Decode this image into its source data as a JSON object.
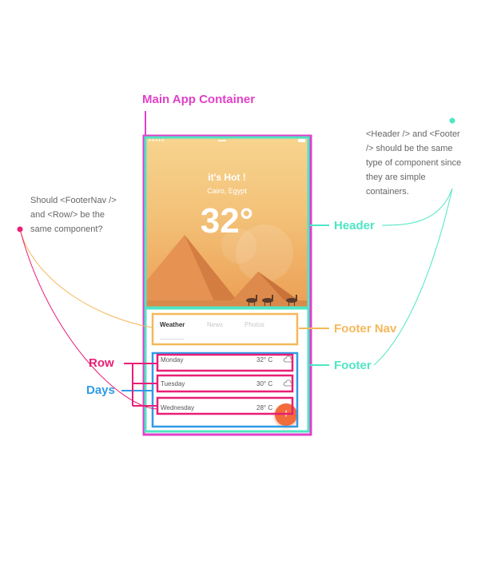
{
  "labels": {
    "main_container": "Main App Container",
    "header": "Header",
    "footer_nav": "Footer Nav",
    "footer": "Footer",
    "row": "Row",
    "days": "Days"
  },
  "notes": {
    "left": [
      "Should <FooterNav />",
      "and <Row/> be the",
      "same component?"
    ],
    "right": [
      "<Header /> and <Footer",
      "/> should be the same",
      "type of component since",
      "they are simple",
      "containers."
    ]
  },
  "app": {
    "hero_title": "it's Hot !",
    "hero_subtitle": "Cairo, Egypt",
    "temperature": "32°",
    "tabs": [
      "Weather",
      "News",
      "Photos"
    ],
    "days": [
      {
        "day": "Monday",
        "temp": "32° C"
      },
      {
        "day": "Tuesday",
        "temp": "30° C"
      },
      {
        "day": "Wednesday",
        "temp": "28° C"
      }
    ],
    "fab_label": "+"
  },
  "colors": {
    "main_container": "#e040c8",
    "header": "#4ee6c4",
    "footer_nav": "#f5b85a",
    "row": "#e91e75",
    "days": "#2f9be6",
    "fab": "#f26b3a"
  }
}
